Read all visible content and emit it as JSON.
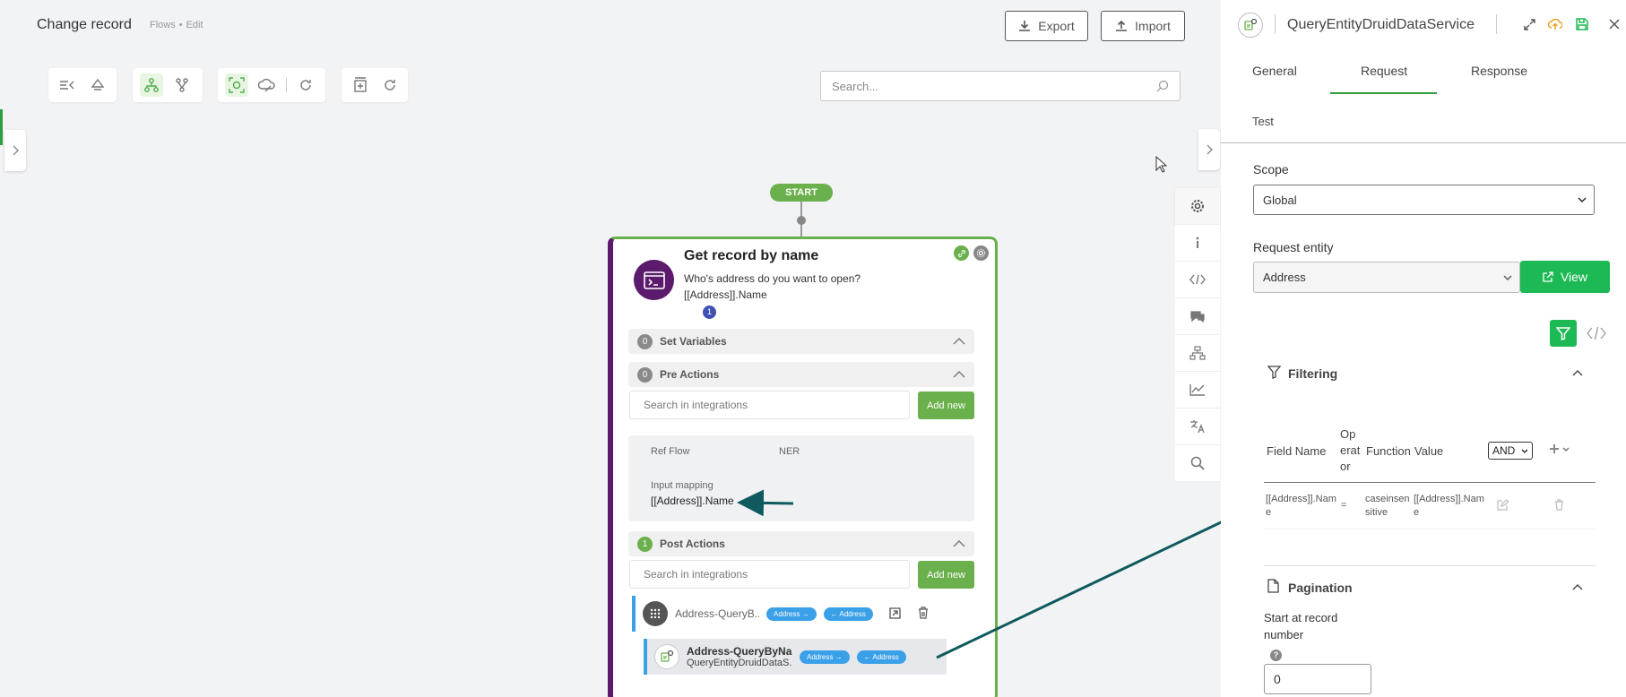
{
  "header": {
    "title": "Change record",
    "crumb_1": "Flows",
    "crumb_2": "Edit",
    "export_label": "Export",
    "import_label": "Import"
  },
  "search": {
    "placeholder": "Search..."
  },
  "flow": {
    "start_label": "START",
    "card": {
      "title": "Get record by name",
      "subtitle_1": "Who's address do you want to open?",
      "subtitle_2": "[[Address]].Name",
      "badge": "1",
      "set_variables": {
        "count": "0",
        "label": "Set Variables"
      },
      "pre_actions": {
        "count": "0",
        "label": "Pre Actions"
      },
      "integration_search_placeholder": "Search in integrations",
      "add_new_label": "Add new",
      "ref_flow_label": "Ref Flow",
      "ref_flow_value": "NER",
      "input_mapping_label": "Input mapping",
      "input_mapping_value": "[[Address]].Name",
      "post_actions": {
        "count": "1",
        "label": "Post Actions"
      },
      "items": [
        {
          "name": "Address-QueryB...",
          "sub": "",
          "chip_in": "Address",
          "chip_out": "Address"
        },
        {
          "name": "Address-QueryByNa...",
          "sub": "QueryEntityDruidDataS...",
          "chip_in": "Address",
          "chip_out": "Address"
        }
      ]
    }
  },
  "panel": {
    "title": "QueryEntityDruidDataService",
    "tabs": [
      "General",
      "Request",
      "Response",
      "Test"
    ],
    "active_tab": "Request",
    "scope_label": "Scope",
    "scope_value": "Global",
    "entity_label": "Request entity",
    "entity_value": "Address",
    "view_label": "View",
    "filtering_label": "Filtering",
    "columns": {
      "field_name": "Field Name",
      "operator_1": "Op",
      "operator_2": "erat",
      "operator_3": "or",
      "function": "Function",
      "value": "Value"
    },
    "logic_value": "AND",
    "filter_row": {
      "field_1": "[[Address]].Nam",
      "field_2": "e",
      "operator": "=",
      "func_1": "caseinsen",
      "func_2": "sitive",
      "value_1": "[[Address]].Nam",
      "value_2": "e"
    },
    "pagination_label": "Pagination",
    "start_label_1": "Start at record",
    "start_label_2": "number",
    "help_glyph": "?",
    "start_value": "0"
  },
  "colors": {
    "accent_green": "#6ab04c",
    "bright_green": "#1db954",
    "purple": "#5b1a6b",
    "chip_blue": "#3aa0e8",
    "arrow_teal": "#0f5a5e"
  }
}
